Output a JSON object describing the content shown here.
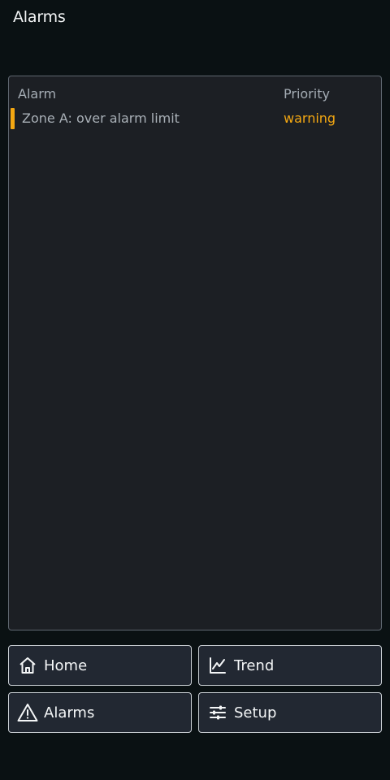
{
  "header": {
    "title": "Alarms"
  },
  "alarm_table": {
    "columns": {
      "alarm": "Alarm",
      "priority": "Priority"
    },
    "rows": [
      {
        "message": "Zone A: over alarm limit",
        "priority": "warning",
        "priority_color": "#f3a712"
      }
    ]
  },
  "nav": {
    "home": {
      "label": "Home",
      "icon": "home-icon"
    },
    "trend": {
      "label": "Trend",
      "icon": "chart-line-icon"
    },
    "alarms": {
      "label": "Alarms",
      "icon": "warning-triangle-icon"
    },
    "setup": {
      "label": "Setup",
      "icon": "sliders-icon"
    }
  },
  "colors": {
    "background": "#0a1113",
    "panel": "#1c1f24",
    "button": "#222832",
    "warning": "#f3a712"
  }
}
